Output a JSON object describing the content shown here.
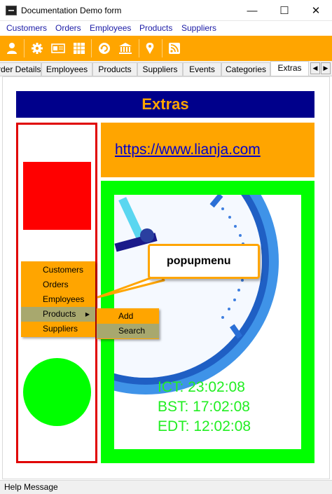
{
  "window": {
    "title": "Documentation Demo form",
    "minimize_glyph": "—",
    "maximize_glyph": "☐",
    "close_glyph": "✕"
  },
  "menu": [
    {
      "label": "Customers"
    },
    {
      "label": "Orders"
    },
    {
      "label": "Employees"
    },
    {
      "label": "Products"
    },
    {
      "label": "Suppliers"
    }
  ],
  "toolbar": {
    "icons": [
      "user-icon",
      "gear-icon",
      "card-icon",
      "grid-icon",
      "refresh-icon",
      "bank-icon",
      "map-pin-icon",
      "rss-icon"
    ],
    "color": "#ffa500"
  },
  "tabs": {
    "items": [
      "rder Details",
      "Employees",
      "Products",
      "Suppliers",
      "Events",
      "Categories",
      "Extras"
    ],
    "active": "Extras",
    "scroll_left": "◀",
    "scroll_right": "▶"
  },
  "page": {
    "header": "Extras",
    "header_bg": "#00008b",
    "header_color": "#ffa500",
    "url": "https://www.lianja.com"
  },
  "popupmenu": {
    "items": [
      "Customers",
      "Orders",
      "Employees",
      "Products",
      "Suppliers"
    ],
    "selected": "Products",
    "submenu_arrow": "▶",
    "submenu": [
      "Add",
      "Search"
    ],
    "submenu_selected": "Search"
  },
  "callout": {
    "text": "popupmenu"
  },
  "times": [
    "ICT: 23:02:08",
    "BST: 17:02:08",
    "EDT: 12:02:08"
  ],
  "status": {
    "message": "Help Message"
  }
}
